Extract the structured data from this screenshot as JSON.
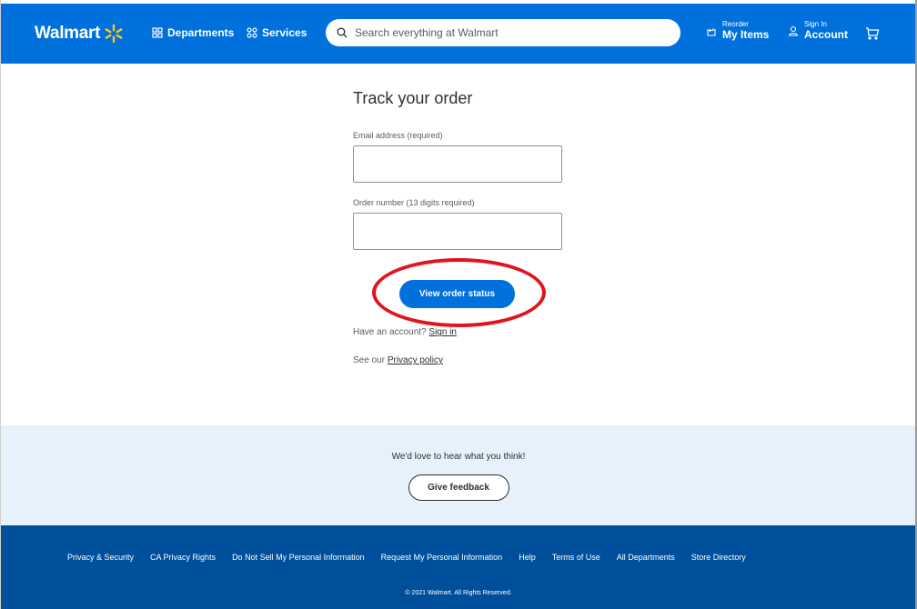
{
  "header": {
    "logo_text": "Walmart",
    "departments_label": "Departments",
    "services_label": "Services",
    "search_placeholder": "Search everything at Walmart",
    "reorder_small": "Reorder",
    "reorder_big": "My Items",
    "signin_small": "Sign In",
    "signin_big": "Account",
    "colors": {
      "brand_blue": "#0071dc",
      "spark_yellow": "#ffc220"
    }
  },
  "main": {
    "title": "Track your order",
    "email_label": "Email address (required)",
    "email_value": "",
    "order_label": "Order number (13 digits required)",
    "order_value": "",
    "submit_label": "View order status",
    "account_prompt": "Have an account?",
    "signin_link": "Sign in",
    "privacy_prompt": "See our",
    "privacy_link": "Privacy policy"
  },
  "feedback": {
    "prompt": "We'd love to hear what you think!",
    "button_label": "Give feedback"
  },
  "footer": {
    "links": [
      "Privacy & Security",
      "CA Privacy Rights",
      "Do Not Sell My Personal Information",
      "Request My Personal Information",
      "Help",
      "Terms of Use",
      "All Departments",
      "Store Directory"
    ],
    "copyright": "© 2021 Walmart. All Rights Reserved."
  },
  "annotation": {
    "color": "#e0141c",
    "target": "View order status"
  }
}
